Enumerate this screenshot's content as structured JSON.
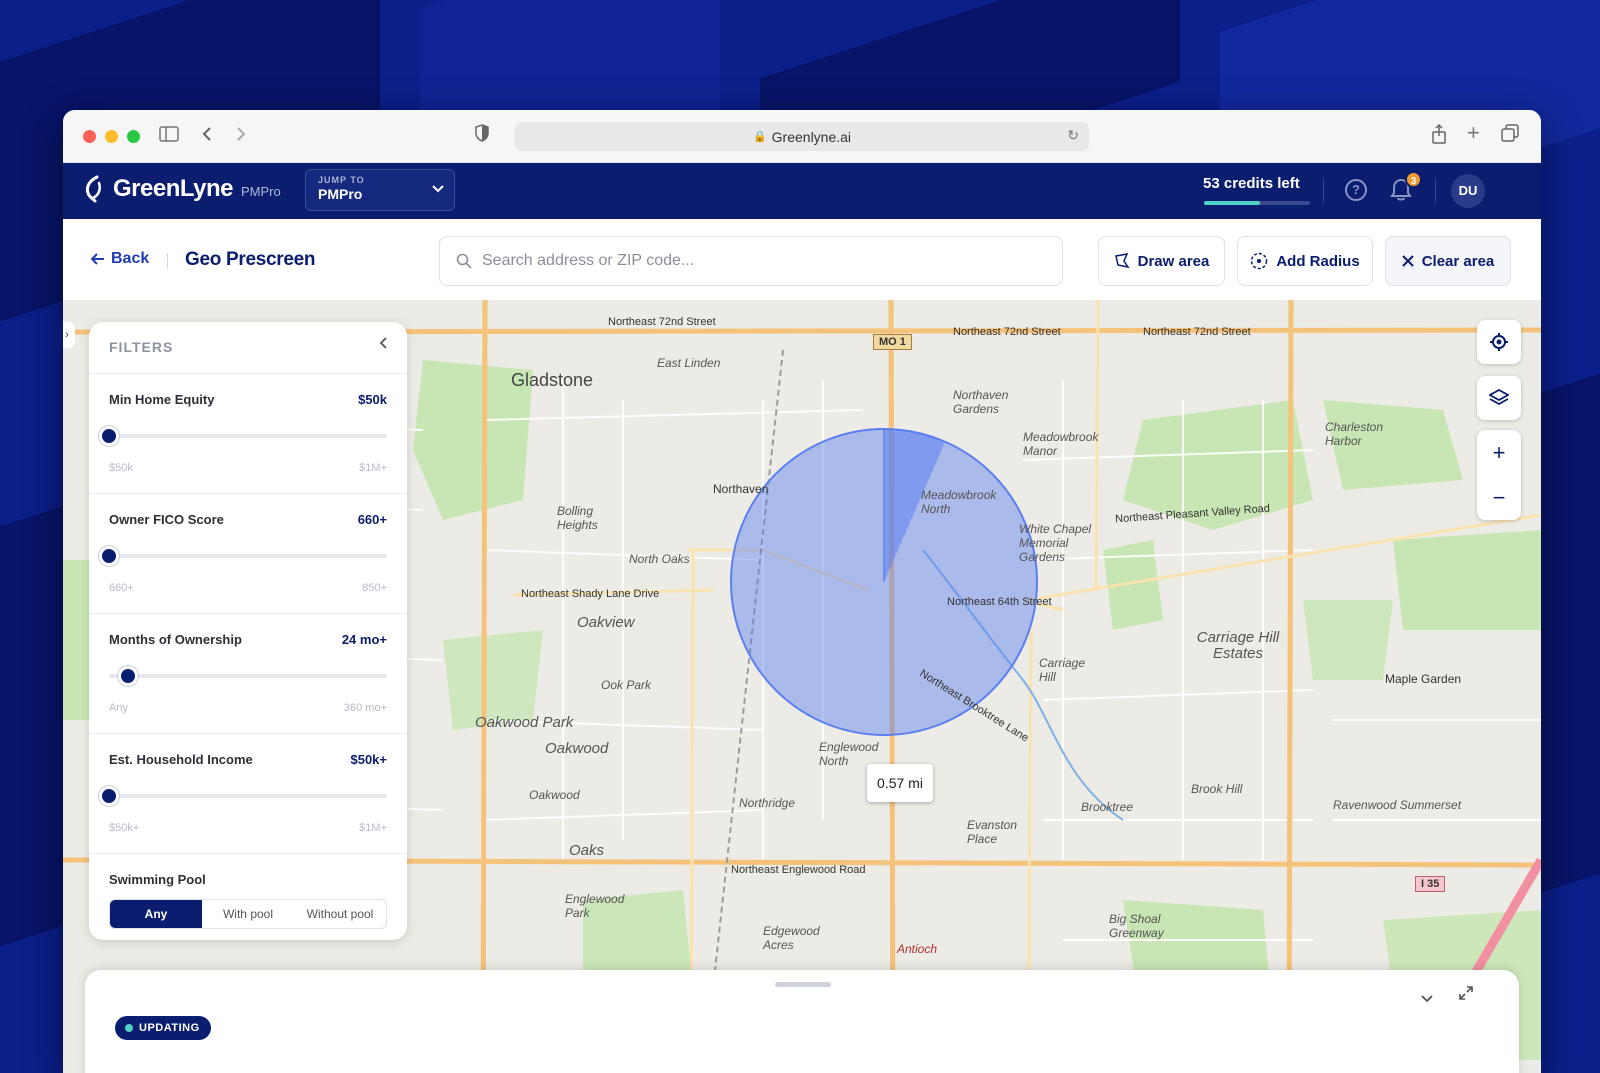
{
  "browser": {
    "url": "Greenlyne.ai"
  },
  "app": {
    "logo_text": "GreenLyne",
    "logo_sub": "PMPro",
    "jump_label": "JUMP TO",
    "jump_value": "PMPro",
    "credits": "53 credits left",
    "credits_fraction": 0.53,
    "notifications_count": "3",
    "avatar_initials": "DU"
  },
  "toolbar": {
    "back_label": "Back",
    "page_title": "Geo Prescreen",
    "search_placeholder": "Search address or ZIP code...",
    "draw_area": "Draw area",
    "add_radius": "Add Radius",
    "clear_area": "Clear area"
  },
  "filters": {
    "title": "FILTERS",
    "groups": [
      {
        "label": "Min Home Equity",
        "value": "$50k",
        "min": "$50k",
        "max": "$1M+",
        "position": 0.0
      },
      {
        "label": "Owner FICO Score",
        "value": "660+",
        "min": "660+",
        "max": "850+",
        "position": 0.0
      },
      {
        "label": "Months of Ownership",
        "value": "24 mo+",
        "min": "Any",
        "max": "360 mo+",
        "position": 0.067
      },
      {
        "label": "Est. Household Income",
        "value": "$50k+",
        "min": "$50k+",
        "max": "$1M+",
        "position": 0.0
      }
    ],
    "pool": {
      "label": "Swimming Pool",
      "options": [
        "Any",
        "With pool",
        "Without pool"
      ],
      "selected": "Any"
    }
  },
  "map": {
    "radius_label": "0.57 mi",
    "labels": {
      "gladstone": "Gladstone",
      "east_linden": "East Linden",
      "ne72_a": "Northeast 72nd Street",
      "ne72_b": "Northeast 72nd Street",
      "ne72_c": "Northeast 72nd Street",
      "mo1": "MO 1",
      "northaven_gardens": "Northaven Gardens",
      "meadowbrook_manor": "Meadowbrook Manor",
      "charleston_harbor": "Charleston Harbor",
      "northaven": "Northaven",
      "meadowbrook_north": "Meadowbrook North",
      "white_chapel": "White Chapel Memorial Gardens",
      "ne_pleasant_valley": "Northeast Pleasant Valley Road",
      "bolling_heights": "Bolling Heights",
      "north_oaks": "North Oaks",
      "ne_shady_lane": "Northeast Shady Lane Drive",
      "ne64": "Northeast 64th Street",
      "oakview": "Oakview",
      "carriage_hill": "Carriage Hill",
      "carriage_hill_estates": "Carriage Hill Estates",
      "maple_garden": "Maple Garden",
      "ook_park": "Ook Park",
      "oakwood_park": "Oakwood Park",
      "oakwood_a": "Oakwood",
      "oakwood_b": "Oakwood",
      "ne_brooktree": "Northeast Brooktree Lane",
      "englewood_north": "Englewood North",
      "northridge": "Northridge",
      "brook_hill": "Brook Hill",
      "brooktree": "Brooktree",
      "ravenwood": "Ravenwood Summerset",
      "oaks": "Oaks",
      "ne_englewood": "Northeast Englewood Road",
      "evanston_place": "Evanston Place",
      "englewood_park": "Englewood Park",
      "edgewood_acres": "Edgewood Acres",
      "big_shoal": "Big Shoal Greenway",
      "i35": "I 35",
      "antioch": "Antioch"
    },
    "colors": {
      "radius_fill": "#5b7ff0",
      "major_road": "#f4c27a",
      "interstate": "#f28fa0",
      "park": "#c8e6b4"
    }
  },
  "sheet": {
    "status": "UPDATING"
  }
}
